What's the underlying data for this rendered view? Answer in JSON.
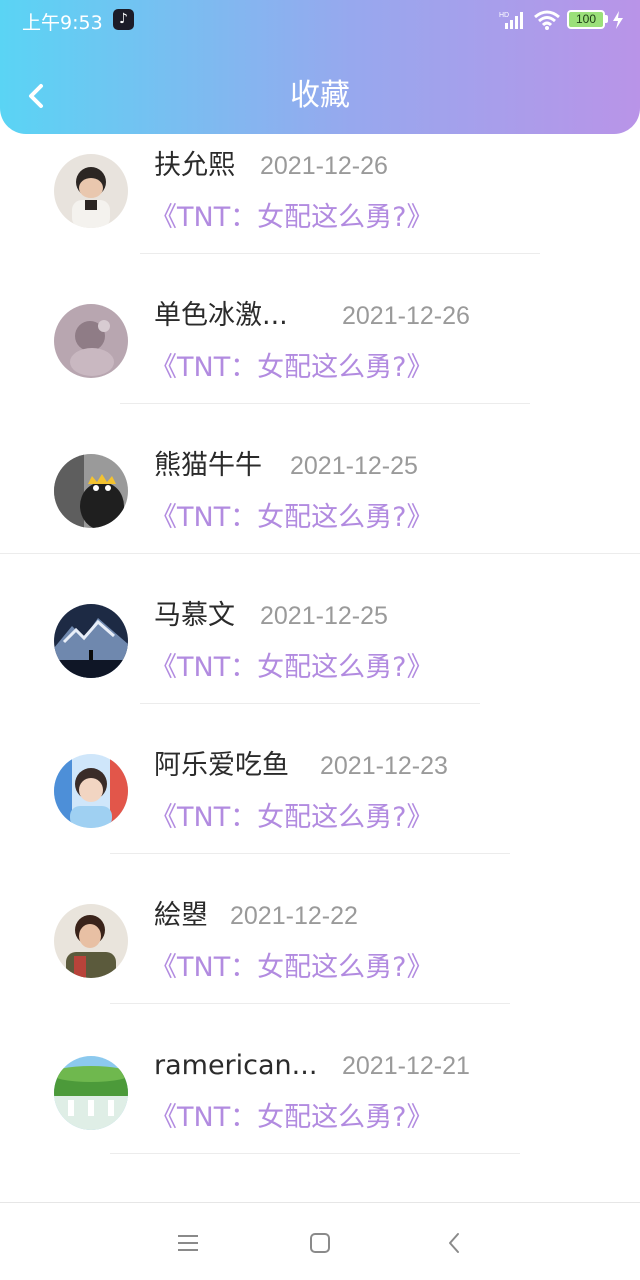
{
  "status_bar": {
    "time": "上午9:53",
    "battery": "100",
    "network_label": "HD"
  },
  "header": {
    "title": "收藏",
    "back_icon": "chevron-left-icon"
  },
  "favorites": [
    {
      "name": "扶允熙",
      "date": "2021-12-26",
      "book": "《TNT：女配这么勇?》"
    },
    {
      "name": "单色冰激...",
      "date": "2021-12-26",
      "book": "《TNT：女配这么勇?》"
    },
    {
      "name": "熊猫牛牛",
      "date": "2021-12-25",
      "book": "《TNT：女配这么勇?》"
    },
    {
      "name": "马慕文",
      "date": "2021-12-25",
      "book": "《TNT：女配这么勇?》"
    },
    {
      "name": "阿乐爱吃鱼",
      "date": "2021-12-23",
      "book": "《TNT：女配这么勇?》"
    },
    {
      "name": "絵曌",
      "date": "2021-12-22",
      "book": "《TNT：女配这么勇?》"
    },
    {
      "name": "ramerican...",
      "date": "2021-12-21",
      "book": "《TNT：女配这么勇?》"
    }
  ],
  "nav": {
    "menu_icon": "menu-icon",
    "home_icon": "home-square-icon",
    "back_icon": "back-triangle-icon"
  },
  "colors": {
    "header_start": "#5ad4f4",
    "header_end": "#b994e8",
    "book_title": "#b28be0",
    "date": "#9a9a9a"
  }
}
